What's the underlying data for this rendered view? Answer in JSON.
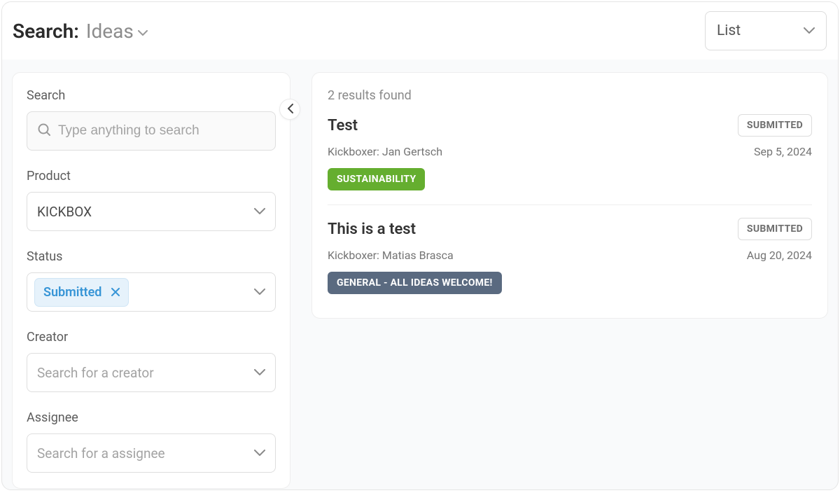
{
  "header": {
    "title": "Search:",
    "subtitle": "Ideas",
    "view_selector": "List"
  },
  "sidebar": {
    "search": {
      "label": "Search",
      "placeholder": "Type anything to search"
    },
    "product": {
      "label": "Product",
      "value": "KICKBOX"
    },
    "status": {
      "label": "Status",
      "chip": "Submitted"
    },
    "creator": {
      "label": "Creator",
      "placeholder": "Search for a creator"
    },
    "assignee": {
      "label": "Assignee",
      "placeholder": "Search for a assignee"
    }
  },
  "results": {
    "summary": "2 results found",
    "items": [
      {
        "title": "Test",
        "status": "SUBMITTED",
        "kickboxer_label": "Kickboxer: ",
        "kickboxer_name": "Jan Gertsch",
        "date": "Sep 5, 2024",
        "tag": "SUSTAINABILITY",
        "tag_color": "green"
      },
      {
        "title": "This is a test",
        "status": "SUBMITTED",
        "kickboxer_label": "Kickboxer: ",
        "kickboxer_name": "Matias Brasca",
        "date": "Aug 20, 2024",
        "tag": "GENERAL - ALL IDEAS WELCOME!",
        "tag_color": "slate"
      }
    ]
  }
}
